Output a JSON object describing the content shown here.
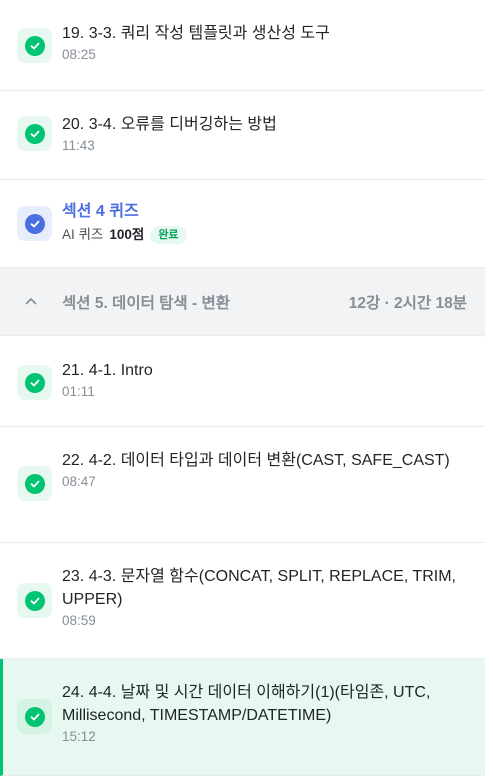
{
  "lectures_before": [
    {
      "title": "19. 3-3. 쿼리 작성 템플릿과 생산성 도구",
      "time": "08:25"
    },
    {
      "title": "20. 3-4. 오류를 디버깅하는 방법",
      "time": "11:43"
    }
  ],
  "quiz": {
    "title": "섹션 4 퀴즈",
    "label": "AI 퀴즈",
    "score": "100점",
    "status": "완료"
  },
  "section": {
    "title": "섹션 5. 데이터 탐색 - 변환",
    "meta": "12강 · 2시간 18분"
  },
  "lectures_after": [
    {
      "title": "21. 4-1. Intro",
      "time": "01:11"
    },
    {
      "title": "22. 4-2. 데이터 타입과 데이터 변환(CAST, SAFE_CAST)",
      "time": "08:47"
    },
    {
      "title": "23. 4-3. 문자열 함수(CONCAT, SPLIT, REPLACE, TRIM, UPPER)",
      "time": "08:59"
    },
    {
      "title": "24. 4-4. 날짜 및 시간 데이터 이해하기(1)(타임존, UTC, Millisecond, TIMESTAMP/DATETIME)",
      "time": "15:12"
    }
  ],
  "colors": {
    "complete_green": "#00c471",
    "quiz_blue": "#4b6ee0",
    "active_bg": "#e6f8ef"
  },
  "icons": {
    "lecture_status": "check-circle-icon",
    "section_toggle": "chevron-up-icon"
  }
}
